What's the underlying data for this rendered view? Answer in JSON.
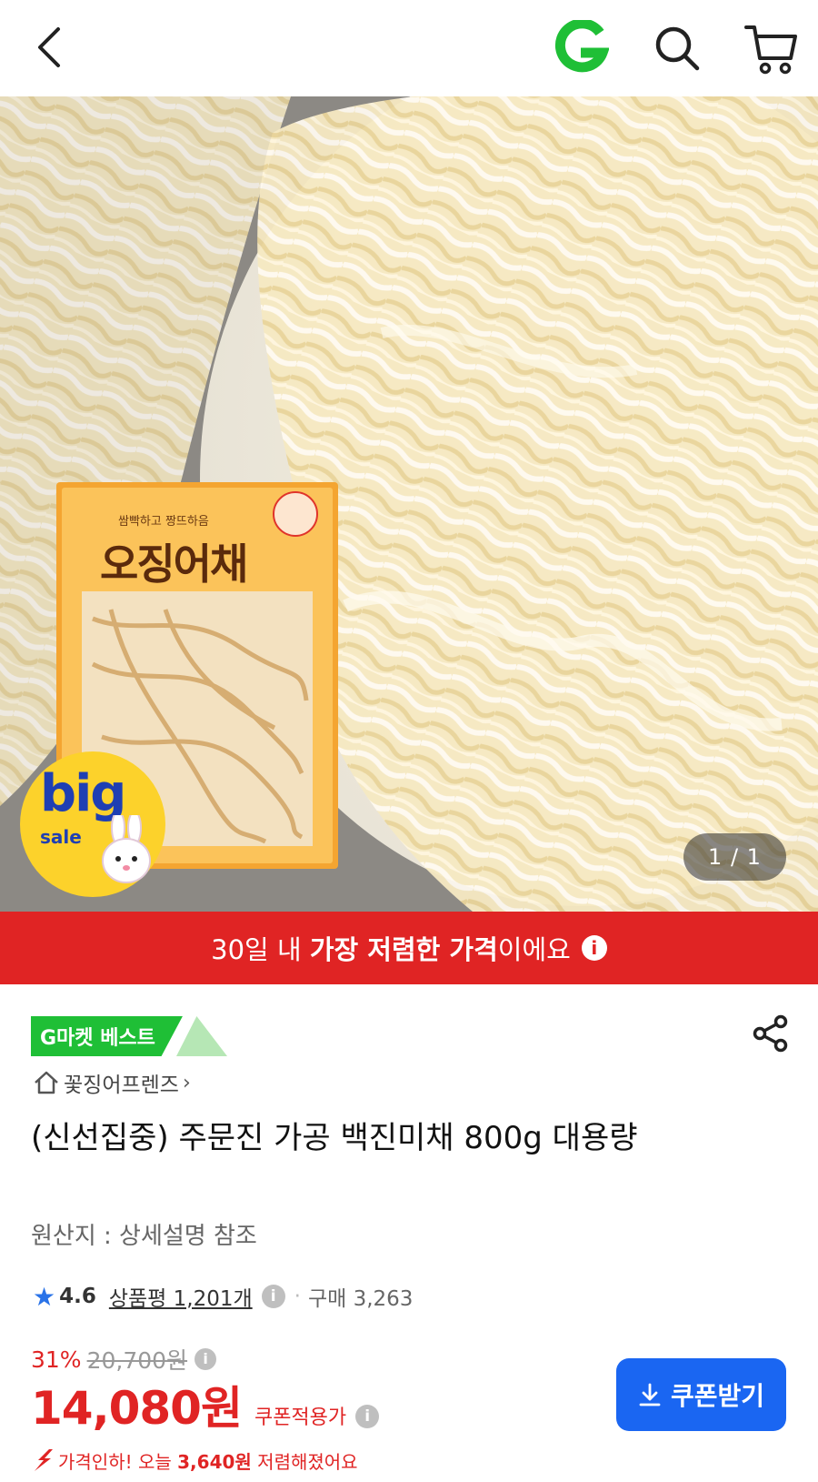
{
  "header": {
    "back_icon": "chevron-left-icon",
    "logo_letter": "G",
    "search_icon": "search-icon",
    "cart_icon": "cart-icon",
    "colors": {
      "logo": "#1fbf36"
    }
  },
  "hero": {
    "pager": "1 / 1",
    "package_text": {
      "brand_line": "쌈빡하고 짱뜨하음",
      "name": "오징어채"
    },
    "big_sale_badge": {
      "word1": "big",
      "word2": "sale"
    }
  },
  "banner": {
    "prefix": "30일 내 ",
    "bold": "가장 저렴한 가격",
    "suffix": "이에요",
    "info_glyph": "i",
    "color": "#e02424"
  },
  "product": {
    "best_badge": "G마켓 베스트",
    "store": "꽃징어프렌즈",
    "store_chevron": "›",
    "title": "(신선집중) 주문진 가공 백진미채 800g 대용량",
    "origin": "원산지 : 상세설명 참조",
    "rating": {
      "score": "4.6",
      "review_label": "상품평 1,201개",
      "purchase_label": "구매 3,263",
      "separator": "·",
      "info_glyph": "i"
    },
    "price": {
      "discount_pct": "31%",
      "original": "20,700원",
      "final": "14,080원",
      "final_label": "쿠폰적용가",
      "info_glyph": "i"
    },
    "coupon_button": "쿠폰받기",
    "price_drop": {
      "prefix": "가격인하! 오늘 ",
      "amount": "3,640원",
      "suffix": " 저렴해졌어요"
    }
  }
}
